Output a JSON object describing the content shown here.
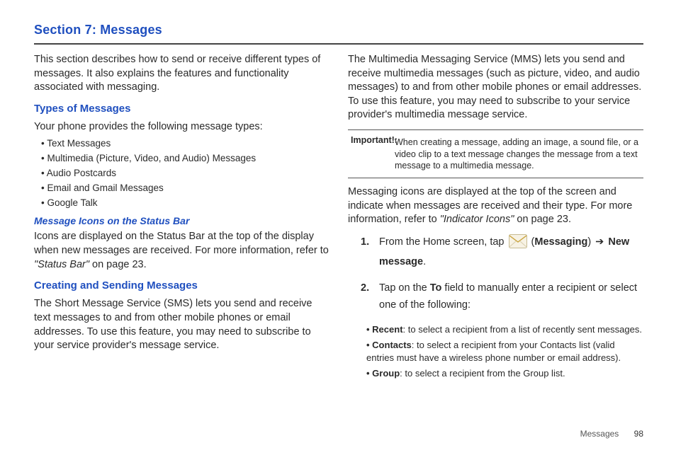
{
  "section_title": "Section 7: Messages",
  "left": {
    "intro": "This section describes how to send or receive different types of messages. It also explains the features and functionality associated with messaging.",
    "types_heading": "Types of Messages",
    "types_lead": "Your phone provides the following message types:",
    "types_list": [
      "Text Messages",
      "Multimedia (Picture, Video, and Audio) Messages",
      "Audio Postcards",
      "Email and Gmail Messages",
      "Google Talk"
    ],
    "icons_heading": "Message Icons on the Status Bar",
    "icons_body_pre": "Icons are displayed on the Status Bar at the top of the display when new messages are received. For more information, refer to ",
    "icons_ref": "\"Status Bar\"",
    "icons_body_post": " on page 23.",
    "create_heading": "Creating and Sending Messages",
    "create_body": "The Short Message Service (SMS) lets you send and receive text messages to and from other mobile phones or email addresses. To use this feature, you may need to subscribe to your service provider's message service."
  },
  "right": {
    "mms_body": "The Multimedia Messaging Service (MMS) lets you send and receive multimedia messages (such as picture, video, and audio messages) to and from other mobile phones or email addresses. To use this feature, you may need to subscribe to your service provider's multimedia message service.",
    "important_label": "Important!:",
    "important_text": "When creating a message, adding an image, a sound file, or a video clip to a text message changes the message from a text message to a multimedia message.",
    "para2_pre": "Messaging icons are displayed at the top of the screen and indicate when messages are received and their type. For more information, refer to ",
    "para2_ref": "\"Indicator Icons\"",
    "para2_post": " on page 23.",
    "step1": {
      "num": "1.",
      "pre": "From the Home screen, tap ",
      "label_messaging": "Messaging",
      "arrow": "➔",
      "label_new": "New message",
      "post": "."
    },
    "step2": {
      "num": "2.",
      "pre": "Tap on the ",
      "to_field": "To",
      "post": " field to manually enter a recipient or select one of the following:"
    },
    "subs": [
      {
        "bold": "Recent",
        "text": ": to select a recipient from a list of recently sent messages."
      },
      {
        "bold": "Contacts",
        "text": ": to select a recipient from your Contacts list (valid entries must have a wireless phone number or email address)."
      },
      {
        "bold": "Group",
        "text": ": to select a recipient from the Group list."
      }
    ]
  },
  "footer": {
    "label": "Messages",
    "page": "98"
  }
}
